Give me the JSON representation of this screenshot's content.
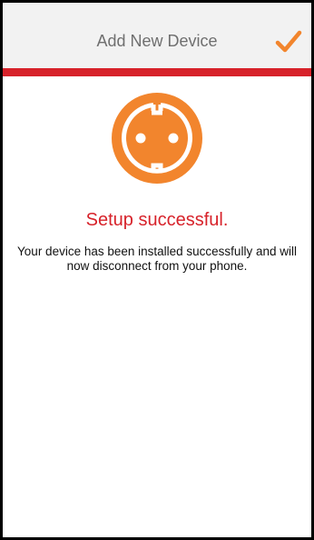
{
  "header": {
    "title": "Add New Device",
    "confirm_icon": "checkmark-icon"
  },
  "colors": {
    "accent_red": "#d7222a",
    "icon_orange": "#f2852d",
    "header_bg": "#f2f2f2"
  },
  "device_icon": "power-socket-icon",
  "status": {
    "title": "Setup successful.",
    "message": "Your device has been installed successfully and will now disconnect from your phone."
  }
}
